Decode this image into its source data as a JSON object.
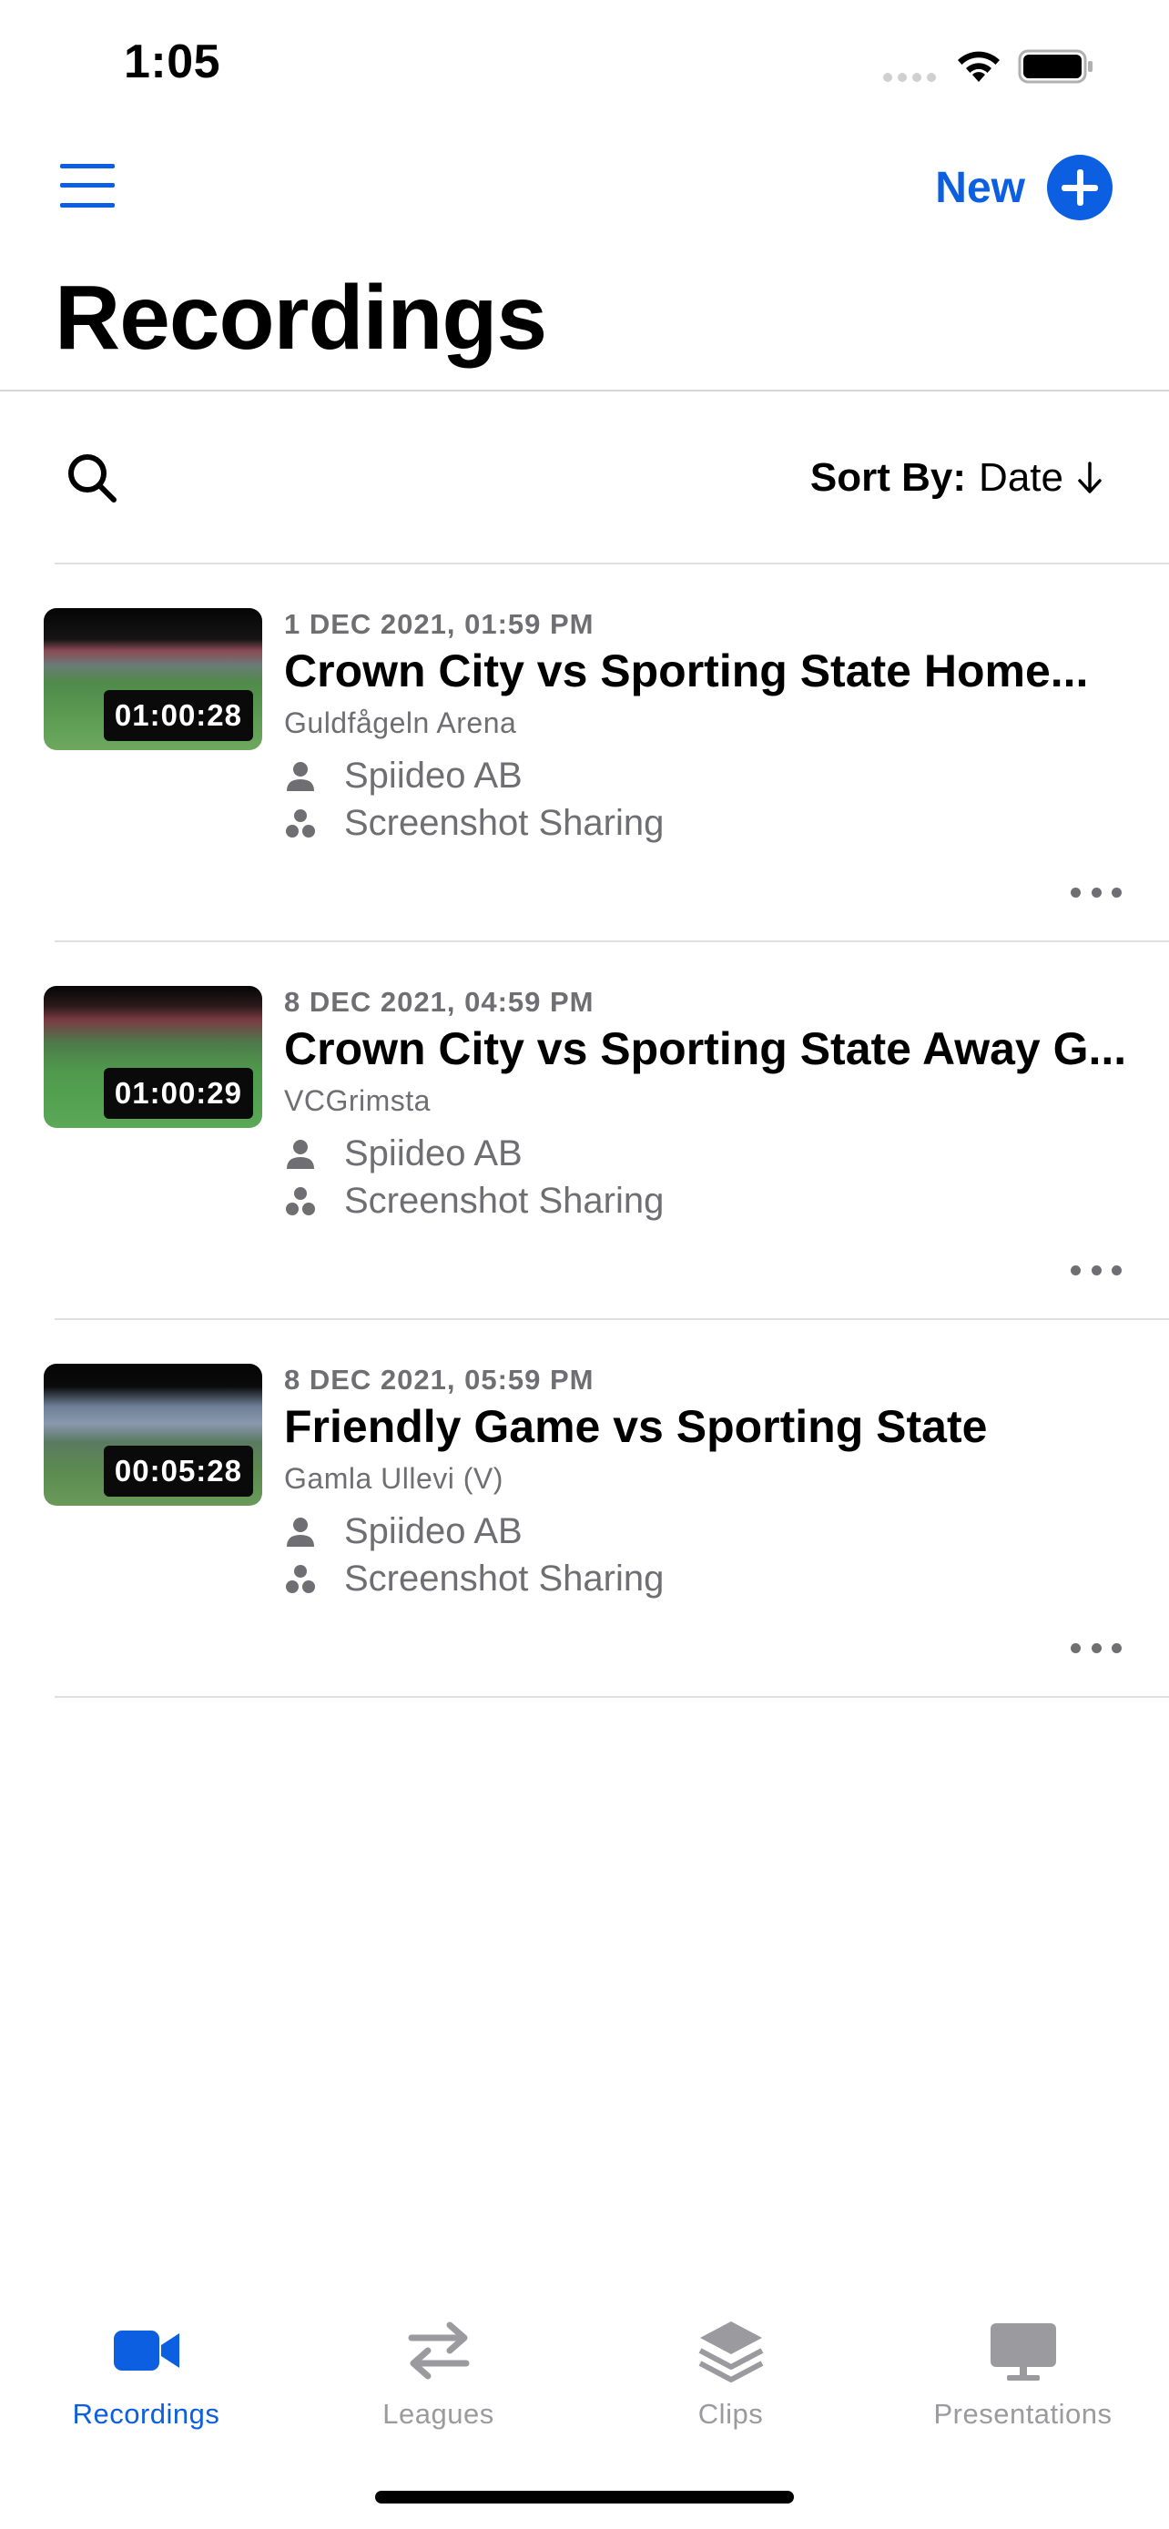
{
  "status_bar": {
    "time": "1:05"
  },
  "header": {
    "menu_icon": "hamburger-menu-icon",
    "new_label": "New",
    "new_icon": "plus-circle-icon",
    "title": "Recordings",
    "accent_color": "#0c5fe0"
  },
  "toolbar": {
    "search_icon": "search-icon",
    "sort_label": "Sort By:",
    "sort_value": "Date",
    "sort_direction": "descending-arrow-icon"
  },
  "recordings": [
    {
      "duration": "01:00:28",
      "date": "1 DEC 2021, 01:59 PM",
      "title": "Crown City vs Sporting State Home...",
      "venue": "Guldfågeln Arena",
      "owner": "Spiideo AB",
      "group": "Screenshot Sharing"
    },
    {
      "duration": "01:00:29",
      "date": "8 DEC 2021, 04:59 PM",
      "title": "Crown City vs Sporting State Away G...",
      "venue": "VCGrimsta",
      "owner": "Spiideo AB",
      "group": "Screenshot Sharing"
    },
    {
      "duration": "00:05:28",
      "date": "8 DEC 2021, 05:59 PM",
      "title": "Friendly Game vs Sporting State",
      "venue": "Gamla Ullevi (V)",
      "owner": "Spiideo AB",
      "group": "Screenshot Sharing"
    }
  ],
  "tabs": [
    {
      "label": "Recordings",
      "icon": "video-camera-icon",
      "active": true
    },
    {
      "label": "Leagues",
      "icon": "swap-arrows-icon",
      "active": false
    },
    {
      "label": "Clips",
      "icon": "layers-icon",
      "active": false
    },
    {
      "label": "Presentations",
      "icon": "monitor-icon",
      "active": false
    }
  ]
}
